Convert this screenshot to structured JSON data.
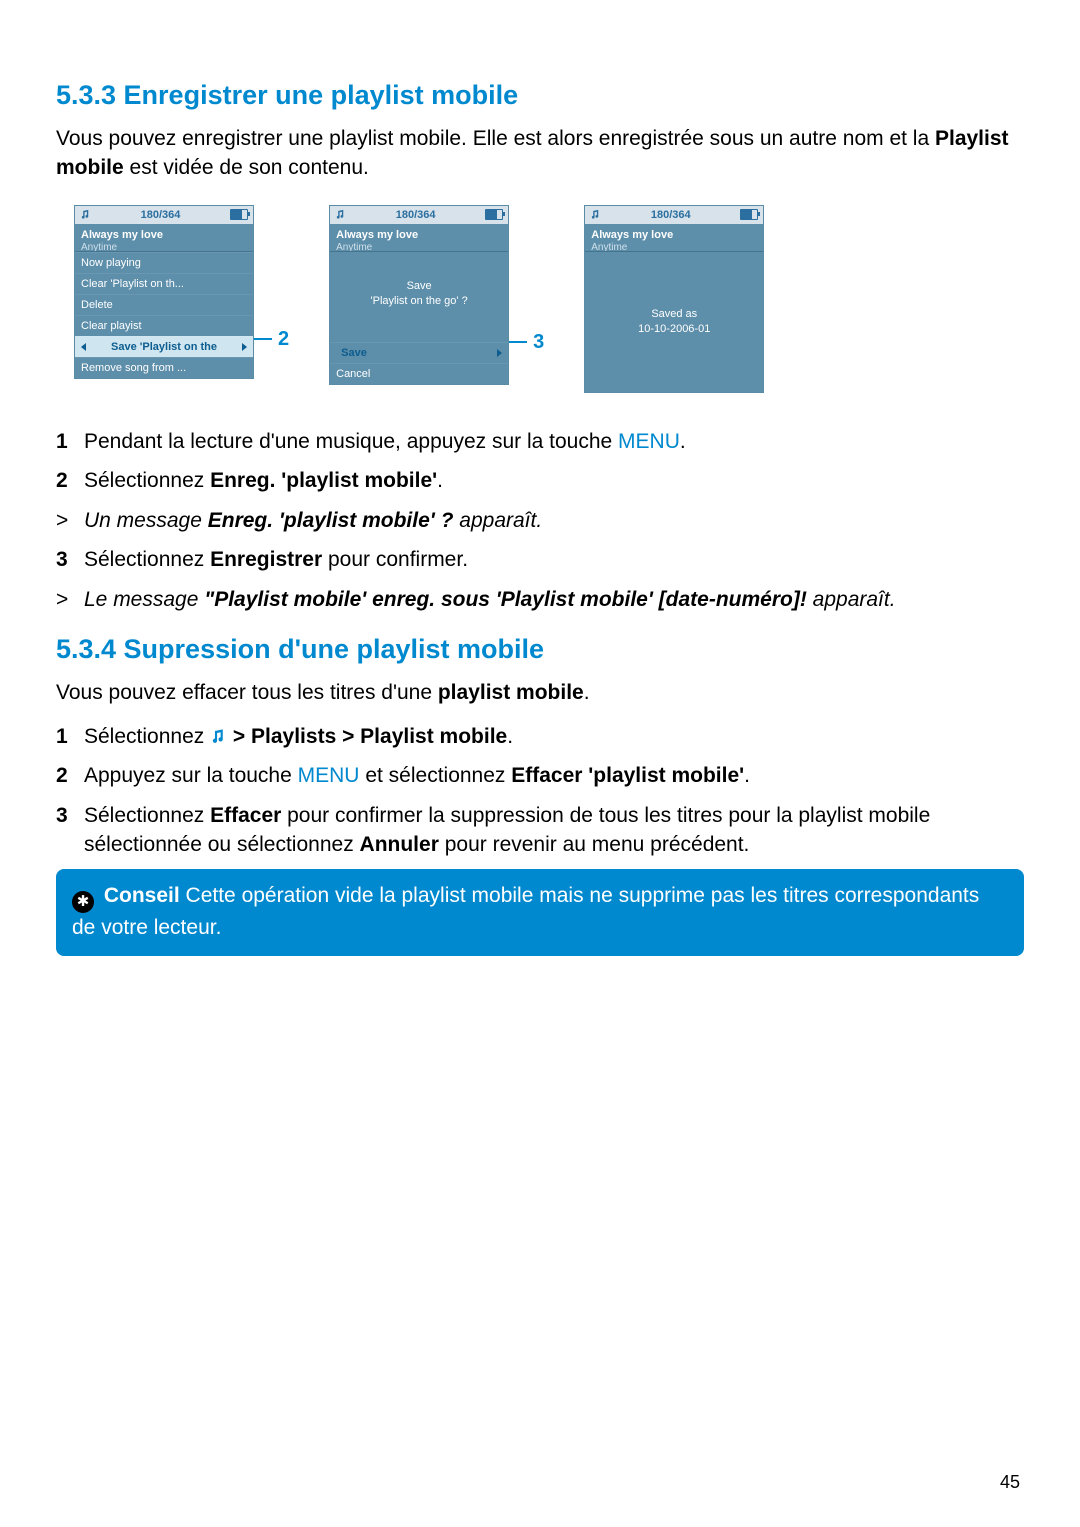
{
  "section533": {
    "heading": "5.3.3 Enregistrer une playlist mobile",
    "intro_pre": "Vous pouvez enregistrer une playlist mobile. Elle est alors enregistrée sous un autre nom et la ",
    "intro_bold": "Playlist mobile",
    "intro_post": " est vidée de son contenu."
  },
  "screens": {
    "counter": "180/364",
    "track_title": "Always my love",
    "track_sub": "Anytime",
    "screen1": {
      "menu": [
        "Now playing",
        "Clear 'Playlist on th...",
        "Delete",
        "Clear playist"
      ],
      "highlight": "Save 'Playlist on the",
      "after": "Remove song from ...",
      "callout": "2"
    },
    "screen2": {
      "msg_l1": "Save",
      "msg_l2": "'Playlist on the go' ?",
      "highlight": "Save",
      "after": "Cancel",
      "callout": "3"
    },
    "screen3": {
      "msg_l1": "Saved as",
      "msg_l2": "10-10-2006-01"
    }
  },
  "steps533": {
    "s1_pre": "Pendant la lecture d'une musique, appuyez sur la touche ",
    "s1_menu": "MENU",
    "s1_post": ".",
    "s2_pre": "Sélectionnez ",
    "s2_bold": "Enreg. 'playlist mobile'",
    "s2_post": ".",
    "r1_pre": "Un message ",
    "r1_bold": "Enreg. 'playlist mobile' ?",
    "r1_post": " apparaît.",
    "s3_pre": "Sélectionnez ",
    "s3_bold": "Enregistrer",
    "s3_post": " pour confirmer.",
    "r2_pre": "Le message ",
    "r2_bold": "\"Playlist mobile' enreg. sous 'Playlist mobile' [date-numéro]!",
    "r2_post": " apparaît."
  },
  "section534": {
    "heading": "5.3.4 Supression d'une playlist mobile",
    "intro_pre": "Vous pouvez effacer tous les titres d'une ",
    "intro_bold": "playlist mobile",
    "intro_post": ".",
    "s1_pre": "Sélectionnez ",
    "s1_bold": " > Playlists > Playlist mobile",
    "s1_post": ".",
    "s2_pre": "Appuyez sur la touche ",
    "s2_menu": "MENU",
    "s2_mid": " et sélectionnez ",
    "s2_bold": "Effacer 'playlist mobile'",
    "s2_post": ".",
    "s3_pre": "Sélectionnez ",
    "s3_bold1": "Effacer",
    "s3_mid1": " pour confirmer la suppression de tous les titres pour la playlist mobile sélectionnée ou sélectionnez ",
    "s3_bold2": "Annuler",
    "s3_mid2": " pour revenir au menu précédent."
  },
  "tip": {
    "label": "Conseil",
    "text": " Cette opération vide la playlist mobile mais ne supprime pas les titres correspondants de votre lecteur."
  },
  "nums": {
    "n1": "1",
    "n2": "2",
    "n3": "3",
    "gt": ">"
  },
  "page": "45"
}
